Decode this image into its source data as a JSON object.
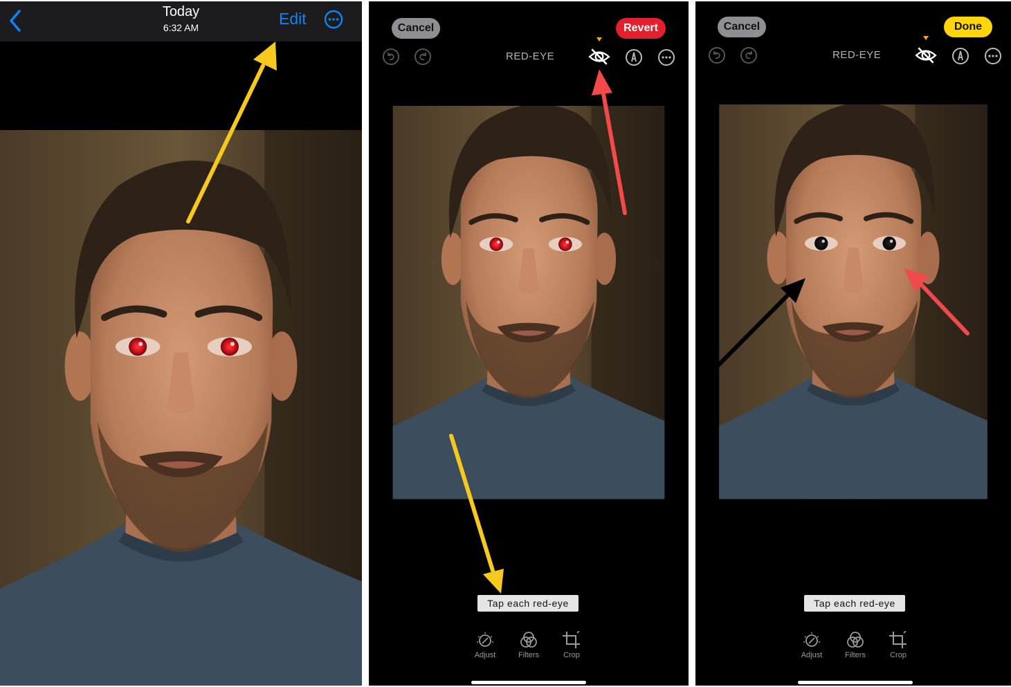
{
  "panel1": {
    "header": {
      "title": "Today",
      "subtitle": "6:32 AM",
      "edit_label": "Edit"
    }
  },
  "panel2": {
    "cancel_label": "Cancel",
    "revert_label": "Revert",
    "mode_label": "RED-EYE",
    "hint": "Tap each red-eye",
    "tools": [
      "Adjust",
      "Filters",
      "Crop"
    ]
  },
  "panel3": {
    "cancel_label": "Cancel",
    "done_label": "Done",
    "mode_label": "RED-EYE",
    "hint": "Tap each red-eye",
    "tools": [
      "Adjust",
      "Filters",
      "Crop"
    ]
  },
  "colors": {
    "accent_blue": "#0a84ff",
    "revert_red": "#e5202e",
    "done_yellow": "#ffd60a",
    "arrow_yellow": "#f7c81e",
    "arrow_red": "#f04a4a",
    "arrow_black": "#000000"
  },
  "icons": {
    "back": "chevron-left-icon",
    "more": "ellipsis-circle-icon",
    "undo": "undo-icon",
    "redo": "redo-icon",
    "red_eye": "eye-slash-icon",
    "markup": "markup-pen-icon",
    "adjust": "adjust-dial-icon",
    "filters": "filters-circles-icon",
    "crop": "crop-icon"
  }
}
